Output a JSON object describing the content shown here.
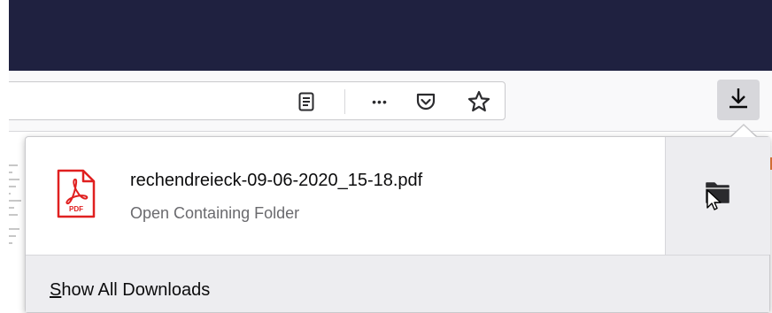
{
  "toolbar": {
    "reader_icon": "reader-view-icon",
    "more_icon": "page-actions-icon",
    "pocket_icon": "pocket-icon",
    "star_icon": "bookmark-star-icon",
    "downloads_icon": "download-arrow-icon",
    "more_glyph": "•••"
  },
  "downloads_panel": {
    "items": [
      {
        "file_name": "rechendreieck-09-06-2020_15-18.pdf",
        "action": "Open Containing Folder",
        "file_icon": "pdf-file-icon",
        "icon_label": "PDF"
      }
    ],
    "folder_button_icon": "folder-icon",
    "footer_label": "Show All Downloads"
  },
  "colors": {
    "titlebar": "#1f2140",
    "pdf_red": "#e02020",
    "panel_footer": "#ededf0"
  }
}
